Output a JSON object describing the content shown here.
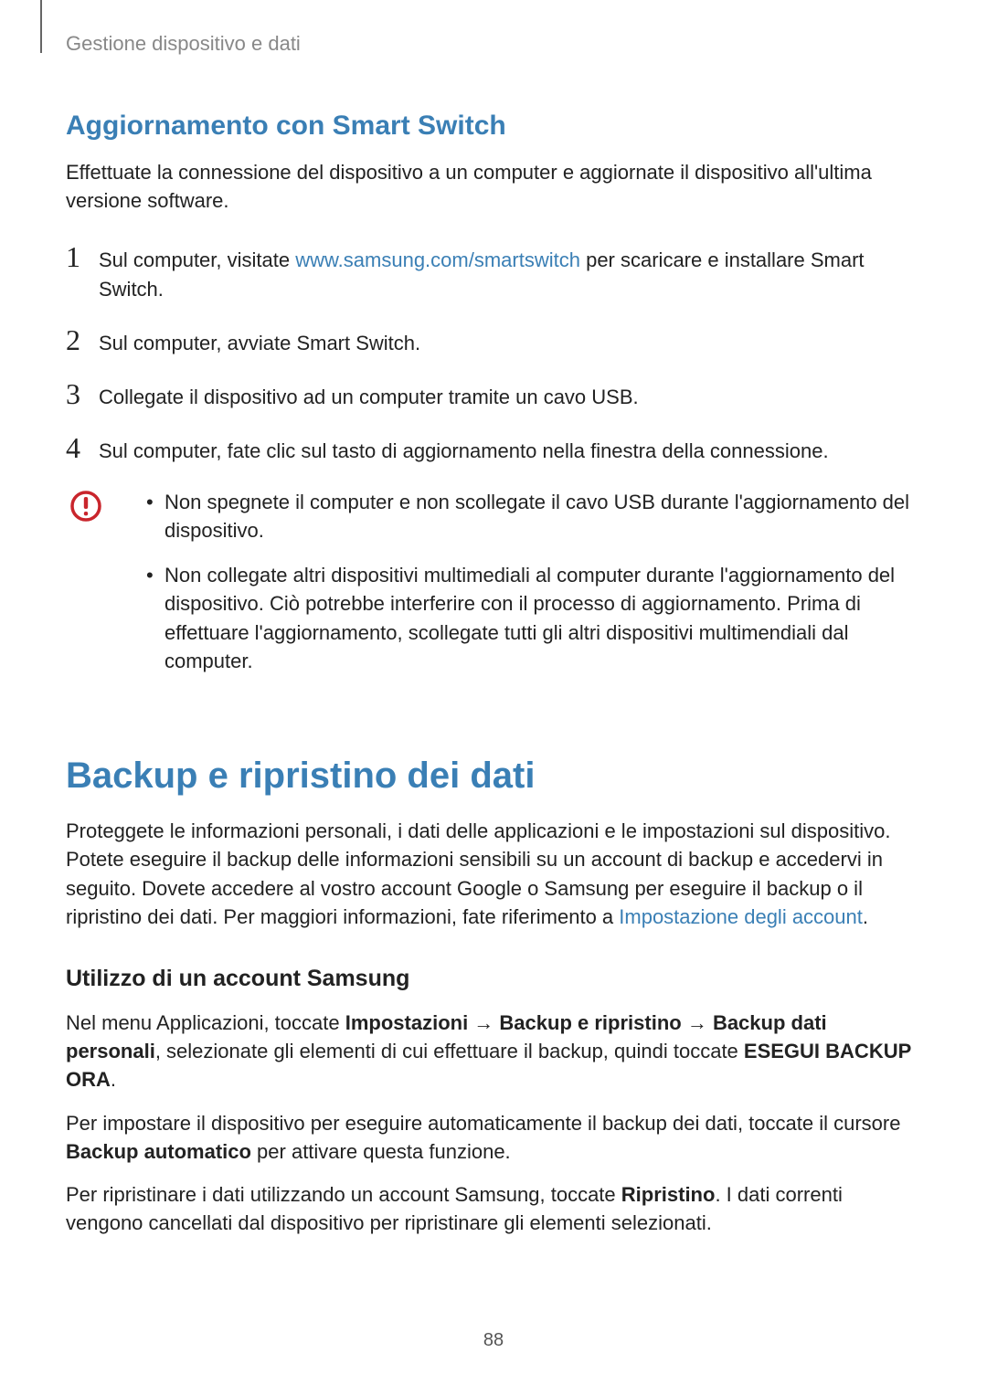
{
  "header": "Gestione dispositivo e dati",
  "section1": {
    "heading": "Aggiornamento con Smart Switch",
    "intro": "Effettuate la connessione del dispositivo a un computer e aggiornate il dispositivo all'ultima versione software.",
    "steps": [
      {
        "num": "1",
        "before": "Sul computer, visitate ",
        "link": "www.samsung.com/smartswitch",
        "after": " per scaricare e installare Smart Switch."
      },
      {
        "num": "2",
        "text": "Sul computer, avviate Smart Switch."
      },
      {
        "num": "3",
        "text": "Collegate il dispositivo ad un computer tramite un cavo USB."
      },
      {
        "num": "4",
        "text": "Sul computer, fate clic sul tasto di aggiornamento nella finestra della connessione."
      }
    ],
    "warnings": [
      "Non spegnete il computer e non scollegate il cavo USB durante l'aggiornamento del dispositivo.",
      "Non collegate altri dispositivi multimediali al computer durante l'aggiornamento del dispositivo. Ciò potrebbe interferire con il processo di aggiornamento. Prima di effettuare l'aggiornamento, scollegate tutti gli altri dispositivi multimendiali dal computer."
    ]
  },
  "section2": {
    "heading": "Backup e ripristino dei dati",
    "intro_before": "Proteggete le informazioni personali, i dati delle applicazioni e le impostazioni sul dispositivo. Potete eseguire il backup delle informazioni sensibili su un account di backup e accedervi in seguito. Dovete accedere al vostro account Google o Samsung per eseguire il backup o il ripristino dei dati. Per maggiori informazioni, fate riferimento a ",
    "intro_link": "Impostazione degli account",
    "intro_after": ".",
    "sub_heading": "Utilizzo di un account Samsung",
    "p1_before": "Nel menu Applicazioni, toccate ",
    "p1_b1": "Impostazioni",
    "p1_arrow1": " → ",
    "p1_b2": "Backup e ripristino",
    "p1_arrow2": " → ",
    "p1_b3": "Backup dati personali",
    "p1_mid": ", selezionate gli elementi di cui effettuare il backup, quindi toccate ",
    "p1_b4": "ESEGUI BACKUP ORA",
    "p1_after": ".",
    "p2_before": "Per impostare il dispositivo per eseguire automaticamente il backup dei dati, toccate il cursore ",
    "p2_b1": "Backup automatico",
    "p2_after": " per attivare questa funzione.",
    "p3_before": "Per ripristinare i dati utilizzando un account Samsung, toccate ",
    "p3_b1": "Ripristino",
    "p3_after": ". I dati correnti vengono cancellati dal dispositivo per ripristinare gli elementi selezionati."
  },
  "page_number": "88",
  "colors": {
    "accent": "#3a7fb5",
    "warning": "#c9252c"
  }
}
